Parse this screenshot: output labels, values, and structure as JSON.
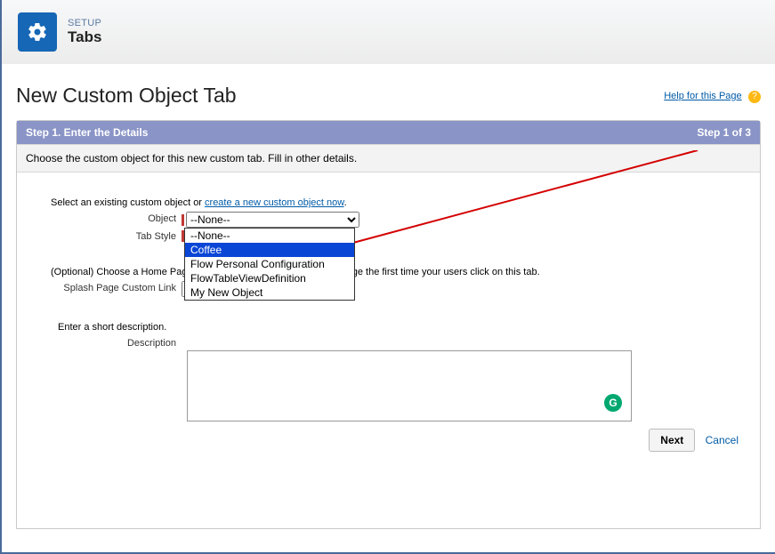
{
  "header": {
    "setup_label": "SETUP",
    "title": "Tabs"
  },
  "page": {
    "title": "New Custom Object Tab",
    "help": "Help for this Page"
  },
  "step": {
    "left": "Step 1. Enter the Details",
    "right": "Step 1 of 3",
    "subtitle": "Choose the custom object for this new custom tab. Fill in other details."
  },
  "select_intro": {
    "prefix": "Select an existing custom object or ",
    "link": "create a new custom object now",
    "suffix": "."
  },
  "labels": {
    "object": "Object",
    "tab_style": "Tab Style",
    "splash_link": "Splash Page Custom Link",
    "description": "Description"
  },
  "object_select": {
    "value": "--None--",
    "options": [
      "--None--",
      "Coffee",
      "Flow Personal Configuration",
      "FlowTableViewDefinition",
      "My New Object"
    ],
    "highlighted_index": 1
  },
  "splash_select": {
    "value": "--None--"
  },
  "optional_intro": "(Optional) Choose a Home Page Custom Link to show as a splash page the first time your users click on this tab.",
  "desc_intro": "Enter a short description.",
  "buttons": {
    "next": "Next",
    "cancel": "Cancel"
  }
}
